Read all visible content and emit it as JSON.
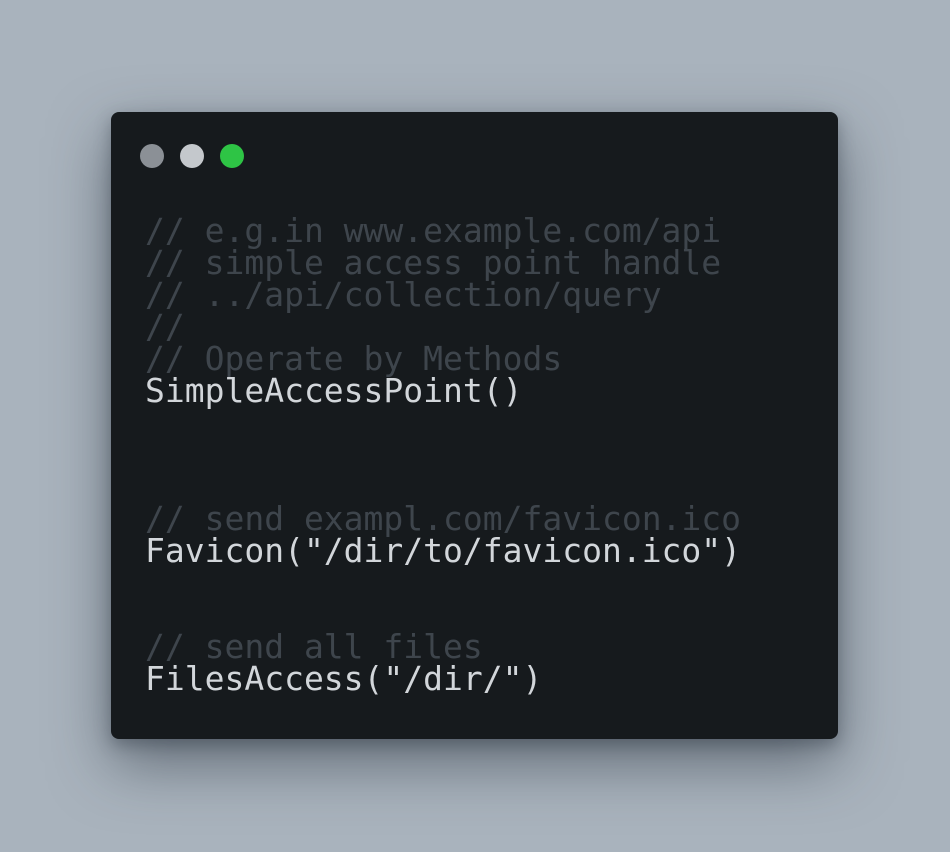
{
  "colors": {
    "background": "#a9b3bd",
    "window": "#161a1d",
    "comment": "#3e454c",
    "code": "#d2d6da",
    "dot_close": "#8b9096",
    "dot_minimize": "#c4c8cc",
    "dot_maximize": "#2ec445"
  },
  "window_controls": [
    {
      "name": "close-dot"
    },
    {
      "name": "minimize-dot"
    },
    {
      "name": "maximize-dot"
    }
  ],
  "code_lines": [
    {
      "kind": "comment",
      "text": "// e.g.in www.example.com/api"
    },
    {
      "kind": "comment",
      "text": "// simple access point handle"
    },
    {
      "kind": "comment",
      "text": "// ../api/collection/query"
    },
    {
      "kind": "comment",
      "text": "//"
    },
    {
      "kind": "comment",
      "text": "// Operate by Methods"
    },
    {
      "kind": "code",
      "text": "SimpleAccessPoint()"
    },
    {
      "kind": "blank",
      "text": ""
    },
    {
      "kind": "blank",
      "text": ""
    },
    {
      "kind": "blank",
      "text": ""
    },
    {
      "kind": "comment",
      "text": "// send exampl.com/favicon.ico"
    },
    {
      "kind": "code",
      "text": "Favicon(\"/dir/to/favicon.ico\")"
    },
    {
      "kind": "blank",
      "text": ""
    },
    {
      "kind": "blank",
      "text": ""
    },
    {
      "kind": "comment",
      "text": "// send all files"
    },
    {
      "kind": "code",
      "text": "FilesAccess(\"/dir/\")"
    }
  ]
}
